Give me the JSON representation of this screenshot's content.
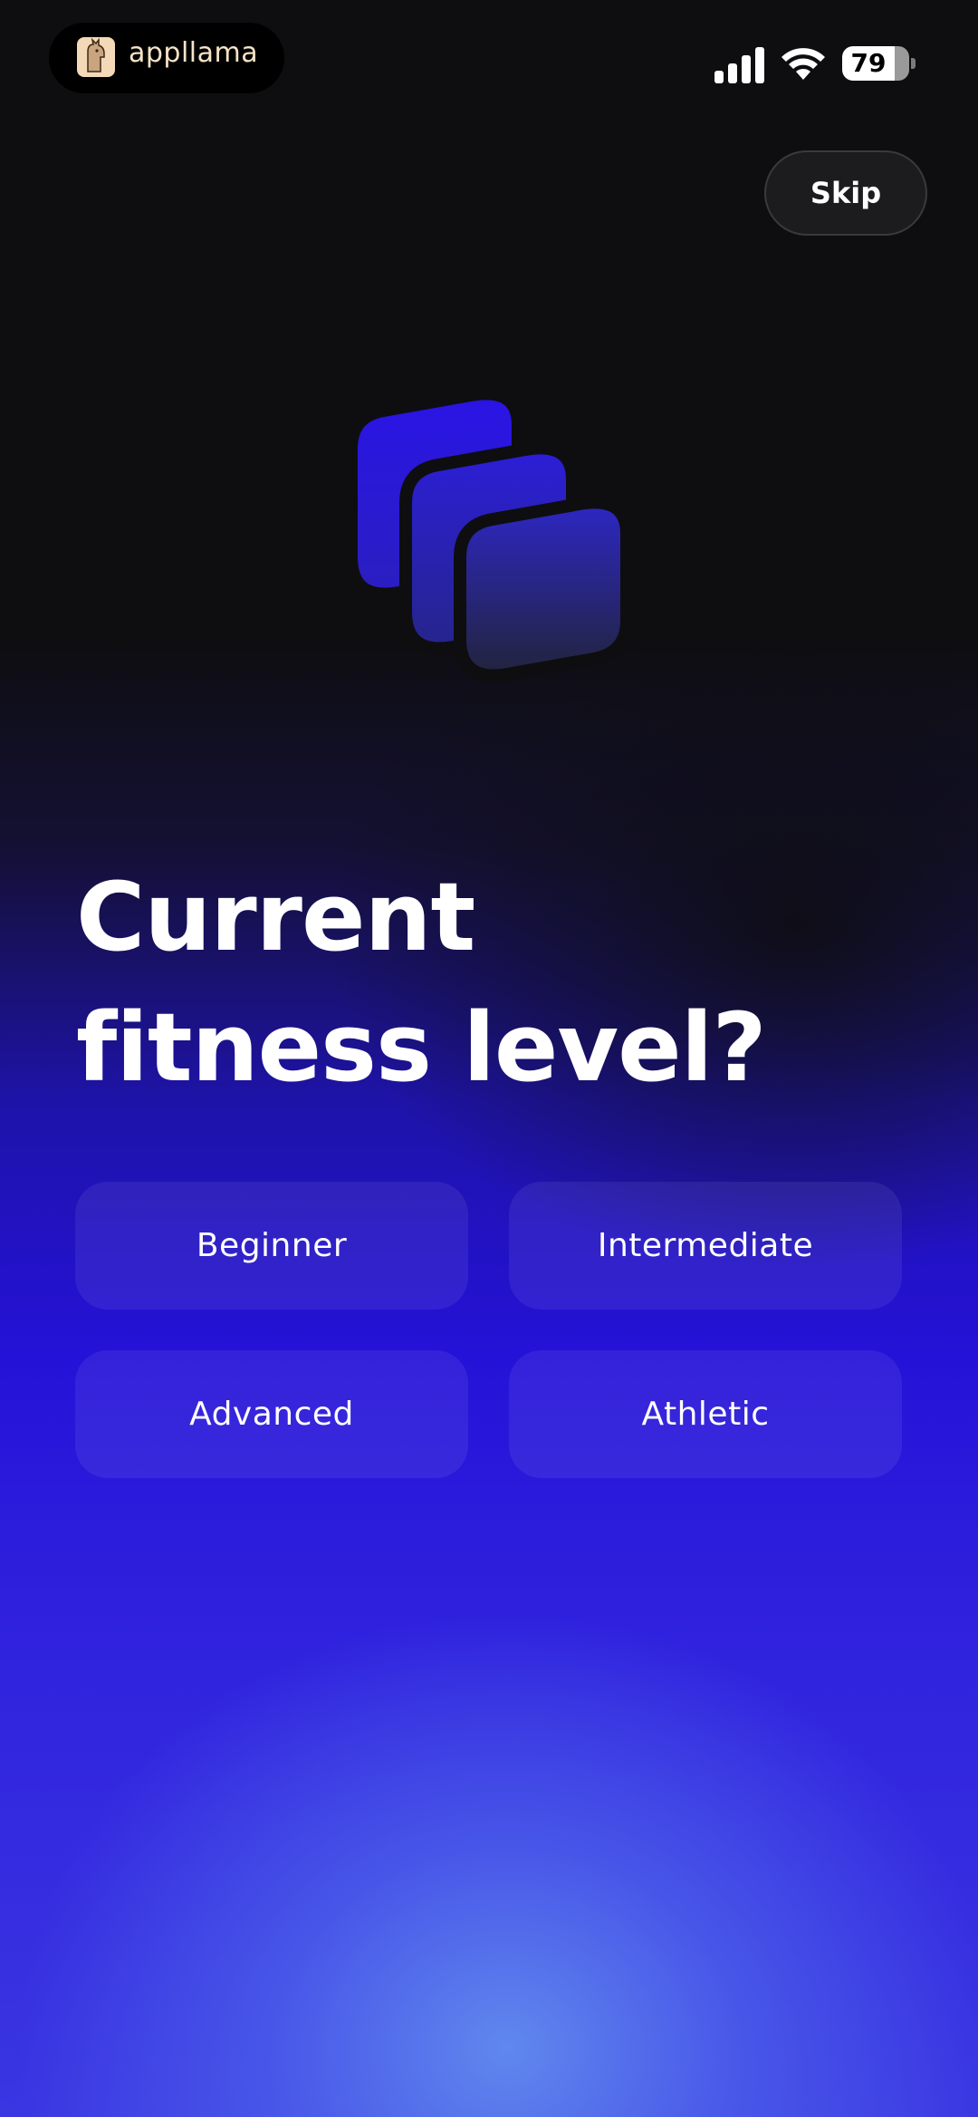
{
  "status_bar": {
    "brand_name": "appllama",
    "battery_level": "79",
    "battery_fraction": 0.79
  },
  "skip_label": "Skip",
  "title": {
    "line1": "Current",
    "line2": "fitness level?"
  },
  "options": [
    {
      "label": "Beginner"
    },
    {
      "label": "Intermediate"
    },
    {
      "label": "Advanced"
    },
    {
      "label": "Athletic"
    }
  ],
  "colors": {
    "accent": "#2a1ae0",
    "background": "#0e0e10",
    "brand_text": "#f6e3c7"
  },
  "icons": {
    "hero": "stacked-cards-icon",
    "signal": "cellular-signal-icon",
    "wifi": "wifi-icon",
    "battery": "battery-icon",
    "logo": "llama-logo-icon"
  }
}
